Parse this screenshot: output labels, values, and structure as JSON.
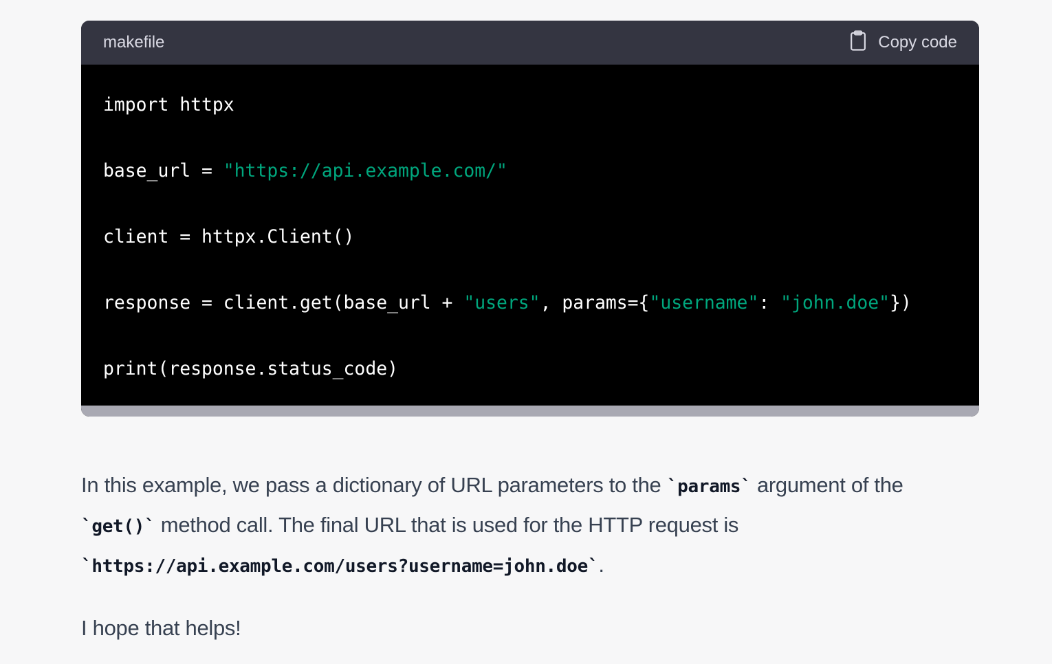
{
  "code_block": {
    "language": "makefile",
    "copy_label": "Copy code",
    "lines": [
      [
        {
          "t": "import httpx",
          "c": "plain"
        }
      ],
      [
        {
          "t": "base_url = ",
          "c": "plain"
        },
        {
          "t": "\"https://api.example.com/\"",
          "c": "str"
        }
      ],
      [
        {
          "t": "client = httpx.Client()",
          "c": "plain"
        }
      ],
      [
        {
          "t": "response = client.get(base_url + ",
          "c": "plain"
        },
        {
          "t": "\"users\"",
          "c": "str"
        },
        {
          "t": ", params={",
          "c": "plain"
        },
        {
          "t": "\"username\"",
          "c": "str"
        },
        {
          "t": ": ",
          "c": "plain"
        },
        {
          "t": "\"john.doe\"",
          "c": "str"
        },
        {
          "t": "})",
          "c": "plain"
        }
      ],
      [
        {
          "t": "print(response.status_code)",
          "c": "plain"
        }
      ]
    ]
  },
  "explanation": {
    "t1": "In this example, we pass a dictionary of URL parameters to the ",
    "c1": "`params`",
    "t2": " argument of the ",
    "c2": "`get()`",
    "t3": " method call. The final URL that is used for the HTTP request is ",
    "c3": "`https://api.example.com/users?username=john.doe`",
    "t4": "."
  },
  "closing": "I hope that helps!",
  "colors": {
    "string": "#00a67d",
    "header_bg": "#343541",
    "code_bg": "#000000",
    "page_bg": "#f7f7f8"
  },
  "icons": {
    "copy": "clipboard-icon"
  }
}
